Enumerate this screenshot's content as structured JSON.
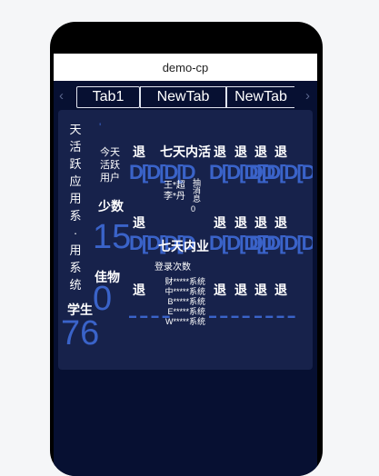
{
  "window": {
    "title": "demo-cp"
  },
  "tabs": {
    "items": [
      {
        "label": "Tab1"
      },
      {
        "label": "NewTab"
      },
      {
        "label": "NewTab"
      }
    ],
    "prev_icon": "chevron-left-icon",
    "next_icon": "chevron-right-icon"
  },
  "dashboard": {
    "col1_vertical": [
      "天",
      "活",
      "跃",
      "应",
      "用",
      "系",
      "·",
      "用",
      "系",
      "统"
    ],
    "col1_label": "学生",
    "col1_value": "76",
    "col2_mark": "'",
    "col2_caption": [
      "今天",
      "活跃",
      "用户"
    ],
    "col2_label1": "少数",
    "col2_value1": "15",
    "col2_label2": "佳物",
    "col2_value2": "0",
    "cell_text": "退",
    "seven_day_1": "七天内活",
    "seven_day_2": "七天内业",
    "users": [
      "王*超",
      "李*丹"
    ],
    "login_count_label": "登录次数",
    "login_zero": "0",
    "systems": [
      "财*****系统",
      "中*****系统",
      "B*****系统",
      "E*****系统",
      "W*****系统"
    ],
    "dash_marks": "D[D[D[D",
    "mini_marks": "▬ ▬ ▬ ▬",
    "tiny_stack": [
      "抽",
      "消",
      "息"
    ]
  },
  "colors": {
    "screen_bg": "#071032",
    "panel_bg": "#17224b",
    "accent_blue": "#3a63c9"
  }
}
